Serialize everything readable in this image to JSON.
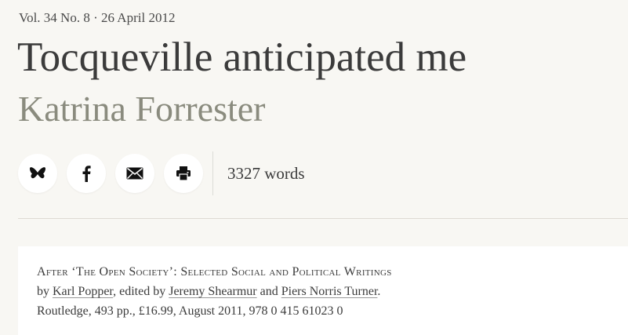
{
  "issue": "Vol. 34 No. 8 · 26 April 2012",
  "title": "Tocqueville anticipated me",
  "author": "Katrina Forrester",
  "share": {
    "icons": [
      "butterfly-icon",
      "facebook-icon",
      "mail-icon",
      "print-icon"
    ]
  },
  "word_count": "3327 words",
  "review": {
    "book_title": "After ‘The Open Society’: Selected Social and Political Writings",
    "by": "by",
    "author_link": "Karl Popper",
    "edited_by": ", edited by",
    "editor1": "Jeremy Shearmur",
    "and": "and",
    "editor2": "Piers Norris Turner",
    "period": ".",
    "publication": "Routledge, 493 pp., £16.99, August 2011, 978 0 415 61023 0"
  }
}
